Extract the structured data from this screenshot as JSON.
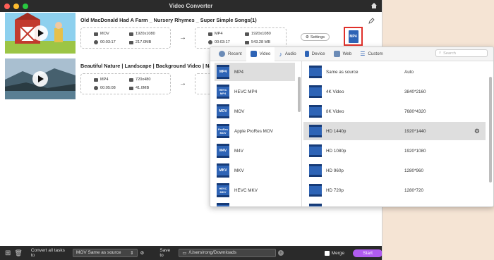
{
  "app": {
    "title": "Video Converter"
  },
  "videos": [
    {
      "title": "Old MacDonald Had A Farm _ Nursery Rhymes _ Super Simple Songs(1)",
      "source": {
        "format": "MOV",
        "resolution": "1920x1080",
        "duration": "00:03:17",
        "size": "217.0MB"
      },
      "target": {
        "format": "MP4",
        "resolution": "1920x1080",
        "duration": "00:03:17",
        "size": "543.28 MB"
      },
      "settings_label": "Settings",
      "format_badge": "MP4"
    },
    {
      "title": "Beautiful Nature | Landscape | Background Video | Na",
      "source": {
        "format": "MP4",
        "resolution": "720x480",
        "duration": "00:05:08",
        "size": "41.0MB"
      }
    }
  ],
  "popup": {
    "tabs": [
      {
        "label": "Recent",
        "icon": "clock-icon"
      },
      {
        "label": "Video",
        "icon": "film-icon"
      },
      {
        "label": "Audio",
        "icon": "music-note-icon"
      },
      {
        "label": "Device",
        "icon": "phone-icon"
      },
      {
        "label": "Web",
        "icon": "play-icon"
      },
      {
        "label": "Custom",
        "icon": "sliders-icon"
      }
    ],
    "search_placeholder": "Search",
    "formats": [
      {
        "label": "MP4",
        "badge": "MP4"
      },
      {
        "label": "HEVC MP4",
        "badge": "HEVC MP4"
      },
      {
        "label": "MOV",
        "badge": "MOV"
      },
      {
        "label": "Apple ProRes MOV",
        "badge": "ProRes MOV"
      },
      {
        "label": "M4V",
        "badge": "M4V"
      },
      {
        "label": "MKV",
        "badge": "MKV"
      },
      {
        "label": "HEVC MKV",
        "badge": "HEVC MKV"
      }
    ],
    "presets": [
      {
        "name": "Same as source",
        "resolution": "Auto"
      },
      {
        "name": "4K Video",
        "resolution": "3840*2160"
      },
      {
        "name": "8K Video",
        "resolution": "7680*4320"
      },
      {
        "name": "HD 1440p",
        "resolution": "1920*1440"
      },
      {
        "name": "HD 1080p",
        "resolution": "1920*1080"
      },
      {
        "name": "HD 960p",
        "resolution": "1280*960"
      },
      {
        "name": "HD 720p",
        "resolution": "1280*720"
      }
    ]
  },
  "bottom_bar": {
    "convert_label": "Convert all tasks to",
    "convert_value": "MOV Same as source",
    "save_label": "Save to",
    "save_path": "/Users/rong/Downloads",
    "merge_label": "Merge",
    "start_label": "Start"
  },
  "colors": {
    "accent": "#2e64b6",
    "highlight": "#e0302a",
    "start_button": "#b05cf0"
  }
}
